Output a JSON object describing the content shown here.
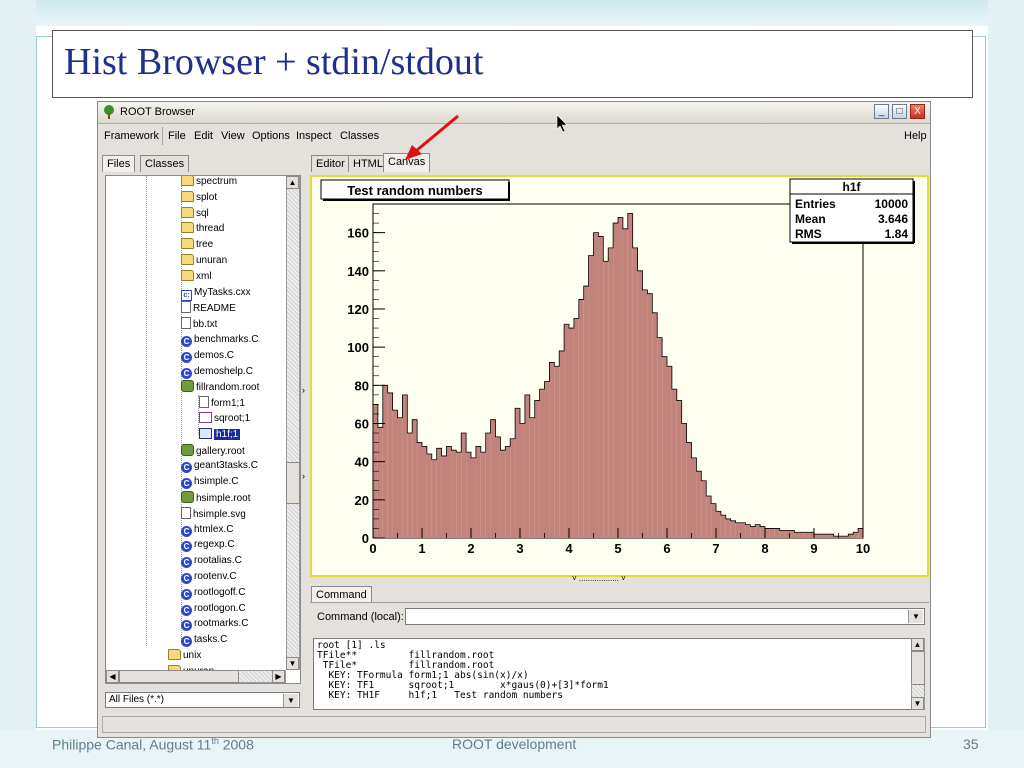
{
  "slide": {
    "title": "Hist Browser + stdin/stdout",
    "footer_author": "Philippe Canal, August 11",
    "footer_sup": "th",
    "footer_year": " 2008",
    "footer_center": "ROOT development",
    "page_number": "35"
  },
  "window": {
    "title": "ROOT Browser",
    "minimize": "_",
    "maximize": "□",
    "close": "X"
  },
  "menu": [
    "Framework",
    "File",
    "Edit",
    "View",
    "Options",
    "Inspect",
    "Classes"
  ],
  "menu_help": "Help",
  "left_tabs": [
    "Files",
    "Classes"
  ],
  "right_tabs": [
    "Editor",
    "HTML",
    "Canvas"
  ],
  "tree": [
    {
      "label": "spectrum",
      "icon": "folder-icon",
      "level": 1
    },
    {
      "label": "splot",
      "icon": "folder-icon",
      "level": 1
    },
    {
      "label": "sql",
      "icon": "folder-icon",
      "level": 1
    },
    {
      "label": "thread",
      "icon": "folder-icon",
      "level": 1
    },
    {
      "label": "tree",
      "icon": "folder-icon",
      "level": 1
    },
    {
      "label": "unuran",
      "icon": "folder-icon",
      "level": 1
    },
    {
      "label": "xml",
      "icon": "folder-icon",
      "level": 1
    },
    {
      "label": "MyTasks.cxx",
      "icon": "cxx-file-icon",
      "level": 1
    },
    {
      "label": "README",
      "icon": "text-file-icon",
      "level": 1
    },
    {
      "label": "bb.txt",
      "icon": "text-file-icon",
      "level": 1
    },
    {
      "label": "benchmarks.C",
      "icon": "macro-file-icon",
      "level": 1
    },
    {
      "label": "demos.C",
      "icon": "macro-file-icon",
      "level": 1
    },
    {
      "label": "demoshelp.C",
      "icon": "macro-file-icon",
      "level": 1
    },
    {
      "label": "fillrandom.root",
      "icon": "root-file-icon",
      "level": 1
    },
    {
      "label": "form1;1",
      "icon": "text-file-icon",
      "level": 2
    },
    {
      "label": "sqroot;1",
      "icon": "function-icon",
      "level": 2
    },
    {
      "label": "h1f;1",
      "icon": "histogram-icon",
      "level": 2,
      "selected": true
    },
    {
      "label": "gallery.root",
      "icon": "root-file-icon",
      "level": 1
    },
    {
      "label": "geant3tasks.C",
      "icon": "macro-file-icon",
      "level": 1
    },
    {
      "label": "hsimple.C",
      "icon": "macro-file-icon",
      "level": 1
    },
    {
      "label": "hsimple.root",
      "icon": "root-file-icon",
      "level": 1
    },
    {
      "label": "hsimple.svg",
      "icon": "text-file-icon",
      "level": 1
    },
    {
      "label": "htmlex.C",
      "icon": "macro-file-icon",
      "level": 1
    },
    {
      "label": "regexp.C",
      "icon": "macro-file-icon",
      "level": 1
    },
    {
      "label": "rootalias.C",
      "icon": "macro-file-icon",
      "level": 1
    },
    {
      "label": "rootenv.C",
      "icon": "macro-file-icon",
      "level": 1
    },
    {
      "label": "rootlogoff.C",
      "icon": "macro-file-icon",
      "level": 1
    },
    {
      "label": "rootlogon.C",
      "icon": "macro-file-icon",
      "level": 1
    },
    {
      "label": "rootmarks.C",
      "icon": "macro-file-icon",
      "level": 1
    },
    {
      "label": "tasks.C",
      "icon": "macro-file-icon",
      "level": 1
    },
    {
      "label": "unix",
      "icon": "folder-icon",
      "level": 0
    },
    {
      "label": "unuran",
      "icon": "folder-icon",
      "level": 0
    }
  ],
  "file_filter": "All Files (*.*)",
  "command_tab": "Command",
  "command_label": "Command (local):",
  "command_value": "",
  "console_text": "root [1] .ls\nTFile**         fillrandom.root\n TFile*         fillrandom.root\n  KEY: TFormula form1;1 abs(sin(x)/x)\n  KEY: TF1      sqroot;1        x*gaus(0)+[3]*form1\n  KEY: TH1F     h1f;1   Test random numbers",
  "colors": {
    "title": "#1f2f8f",
    "hist_fill": "#c2847a",
    "canvas_border": "#e1dc3a",
    "arrow": "#e01010",
    "selection": "#1a2d9e"
  },
  "stats": {
    "name": "h1f",
    "rows": [
      {
        "label": "Entries",
        "value": "10000"
      },
      {
        "label": "Mean",
        "value": "3.646"
      },
      {
        "label": "RMS",
        "value": "1.84"
      }
    ]
  },
  "chart_data": {
    "type": "bar",
    "title": "Test random numbers",
    "xlabel": "",
    "ylabel": "",
    "xlim": [
      0,
      10
    ],
    "ylim": [
      0,
      175
    ],
    "x_ticks": [
      "0",
      "1",
      "2",
      "3",
      "4",
      "5",
      "6",
      "7",
      "8",
      "9",
      "10"
    ],
    "y_ticks": [
      "0",
      "20",
      "40",
      "60",
      "80",
      "100",
      "120",
      "140",
      "160"
    ],
    "bin_width": 0.1,
    "values": [
      70,
      58,
      80,
      76,
      67,
      63,
      75,
      55,
      62,
      50,
      48,
      44,
      41,
      47,
      43,
      48,
      46,
      45,
      55,
      45,
      42,
      48,
      45,
      55,
      62,
      53,
      46,
      48,
      52,
      68,
      60,
      75,
      63,
      72,
      78,
      82,
      92,
      90,
      98,
      112,
      110,
      115,
      125,
      132,
      148,
      160,
      158,
      145,
      152,
      165,
      168,
      162,
      170,
      152,
      140,
      130,
      128,
      118,
      105,
      95,
      90,
      78,
      72,
      60,
      50,
      42,
      35,
      30,
      22,
      18,
      14,
      12,
      10,
      9,
      8,
      8,
      7,
      6,
      7,
      6,
      5,
      5,
      5,
      4,
      4,
      4,
      3,
      3,
      3,
      3,
      2,
      2,
      2,
      2,
      1,
      1,
      1,
      2,
      3,
      5
    ]
  }
}
